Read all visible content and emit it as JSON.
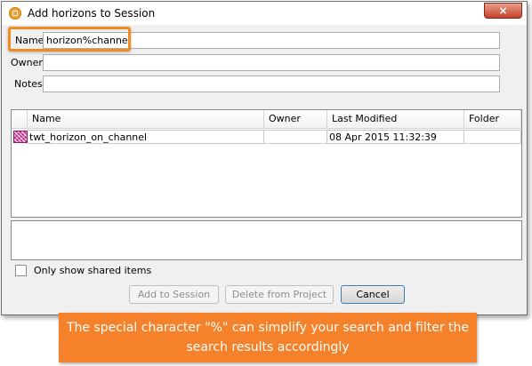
{
  "window": {
    "title": "Add horizons to Session",
    "close_label": "×"
  },
  "form": {
    "name_label": "Name",
    "name_value": "horizon%channel",
    "owner_label": "Owner",
    "owner_value": "",
    "notes_label": "Notes",
    "notes_value": ""
  },
  "table": {
    "columns": [
      "Name",
      "Owner",
      "Last Modified",
      "Folder"
    ],
    "rows": [
      {
        "name": "twt_horizon_on_channel",
        "owner": "",
        "last_modified": "08 Apr 2015 11:32:39",
        "folder": ""
      }
    ]
  },
  "options": {
    "only_shared_label": "Only show shared items",
    "only_shared_checked": false
  },
  "buttons": {
    "add": "Add to Session",
    "delete": "Delete from Project",
    "cancel": "Cancel"
  },
  "callout": {
    "line1": "The special character \"%\" can simplify your search and filter the",
    "line2": "search results accordingly"
  },
  "colors": {
    "accent": "#f5822a",
    "highlight_border": "#f08c1f",
    "close_button": "#c7402a"
  }
}
